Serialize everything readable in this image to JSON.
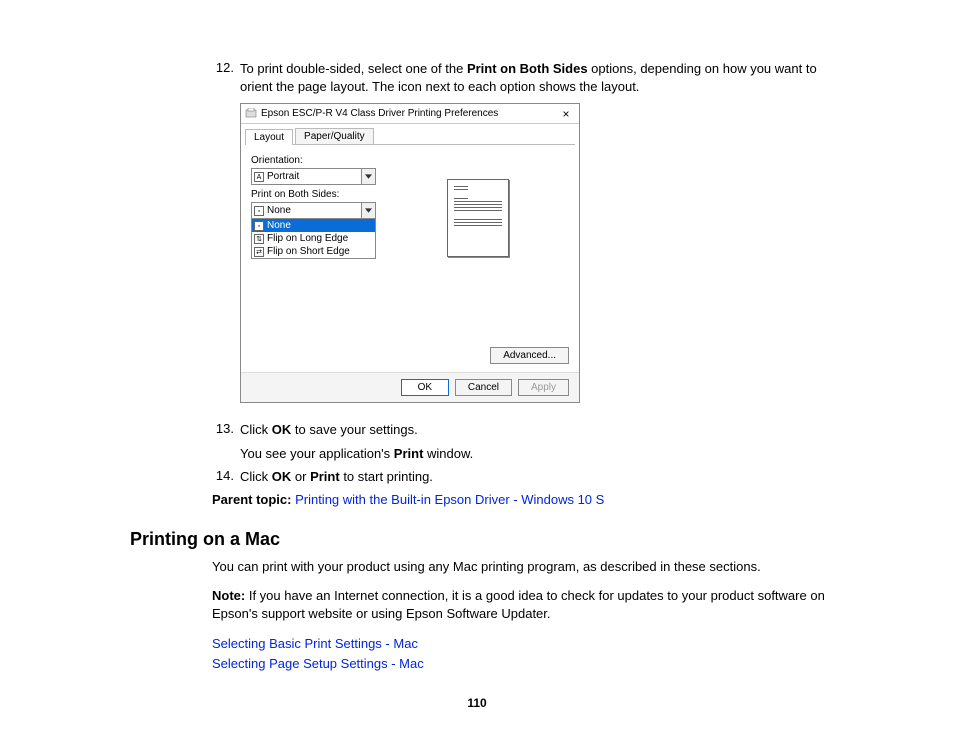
{
  "steps": {
    "s12_num": "12.",
    "s12_pre": "To print double-sided, select one of the ",
    "s12_bold": "Print on Both Sides",
    "s12_post": " options, depending on how you want to orient the page layout. The icon next to each option shows the layout.",
    "s13_num": "13.",
    "s13_a": "Click ",
    "s13_b": "OK",
    "s13_c": " to save your settings.",
    "s13_sub_a": "You see your application's ",
    "s13_sub_b": "Print",
    "s13_sub_c": " window.",
    "s14_num": "14.",
    "s14_a": "Click ",
    "s14_b": "OK",
    "s14_c": " or ",
    "s14_d": "Print",
    "s14_e": " to start printing."
  },
  "parent": {
    "label": "Parent topic: ",
    "link": "Printing with the Built-in Epson Driver - Windows 10 S"
  },
  "heading": "Printing on a Mac",
  "para1": "You can print with your product using any Mac printing program, as described in these sections.",
  "note_b": "Note:",
  "note_rest": " If you have an Internet connection, it is a good idea to check for updates to your product software on Epson's support website or using Epson Software Updater.",
  "links": {
    "l1": "Selecting Basic Print Settings - Mac",
    "l2": "Selecting Page Setup Settings - Mac"
  },
  "pagenum": "110",
  "dialog": {
    "title": "Epson ESC/P-R V4 Class Driver Printing Preferences",
    "close": "×",
    "tab1": "Layout",
    "tab2": "Paper/Quality",
    "orientation_label": "Orientation:",
    "orientation_value": "Portrait",
    "duplex_label": "Print on Both Sides:",
    "duplex_value": "None",
    "opt_none": "None",
    "opt_long": "Flip on Long Edge",
    "opt_short": "Flip on Short Edge",
    "advanced": "Advanced...",
    "ok": "OK",
    "cancel": "Cancel",
    "apply": "Apply"
  }
}
